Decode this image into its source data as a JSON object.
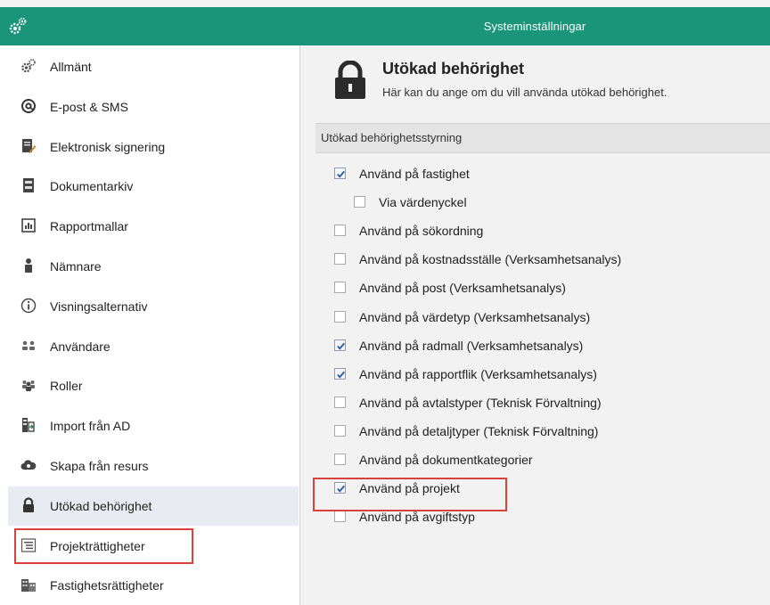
{
  "window": {
    "title": "Systeminställningar",
    "accent_color": "#1a9579",
    "app_icon": "gears-icon"
  },
  "sidebar": {
    "items": [
      {
        "label": "Allmänt",
        "icon": "gears-icon"
      },
      {
        "label": "E-post & SMS",
        "icon": "at-sign-icon"
      },
      {
        "label": "Elektronisk signering",
        "icon": "document-pen-icon"
      },
      {
        "label": "Dokumentarkiv",
        "icon": "archive-icon"
      },
      {
        "label": "Rapportmallar",
        "icon": "report-icon"
      },
      {
        "label": "Nämnare",
        "icon": "person-icon"
      },
      {
        "label": "Visningsalternativ",
        "icon": "info-icon"
      },
      {
        "label": "Användare",
        "icon": "users-icon"
      },
      {
        "label": "Roller",
        "icon": "roles-icon"
      },
      {
        "label": "Import från AD",
        "icon": "import-icon"
      },
      {
        "label": "Skapa från resurs",
        "icon": "cloud-icon"
      },
      {
        "label": "Utökad behörighet",
        "icon": "lock-icon",
        "selected": true
      },
      {
        "label": "Projekträttigheter",
        "icon": "project-list-icon",
        "highlighted": true
      },
      {
        "label": "Fastighetsrättigheter",
        "icon": "buildings-icon"
      }
    ]
  },
  "content": {
    "title": "Utökad behörighet",
    "description": "Här kan du ange om du vill använda utökad behörighet.",
    "section_label": "Utökad behörighetsstyrning",
    "options": [
      {
        "label": "Använd på fastighet",
        "checked": true
      },
      {
        "label": "Via värdenyckel",
        "checked": false,
        "indent": true
      },
      {
        "label": "Använd på sökordning",
        "checked": false
      },
      {
        "label": "Använd på kostnadsställe (Verksamhetsanalys)",
        "checked": false
      },
      {
        "label": "Använd på post (Verksamhetsanalys)",
        "checked": false
      },
      {
        "label": "Använd på värdetyp (Verksamhetsanalys)",
        "checked": false
      },
      {
        "label": "Använd på radmall (Verksamhetsanalys)",
        "checked": true
      },
      {
        "label": "Använd på rapportflik (Verksamhetsanalys)",
        "checked": true
      },
      {
        "label": "Använd på avtalstyper (Teknisk Förvaltning)",
        "checked": false
      },
      {
        "label": "Använd på detaljtyper (Teknisk Förvaltning)",
        "checked": false
      },
      {
        "label": "Använd på dokumentkategorier",
        "checked": false
      },
      {
        "label": "Använd på projekt",
        "checked": true,
        "highlighted": true
      },
      {
        "label": "Använd på avgiftstyp",
        "checked": false
      }
    ]
  },
  "colors": {
    "highlight": "#d9413a",
    "selected_row": "#e8ebf2",
    "check_mark": "#2d5c99"
  }
}
